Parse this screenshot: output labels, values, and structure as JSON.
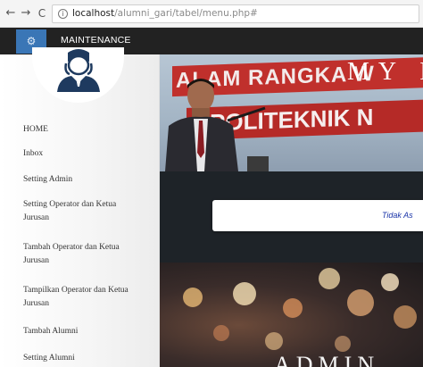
{
  "browser": {
    "url_host": "localhost",
    "url_rest": "/alumni_gari/tabel/menu.php#"
  },
  "app": {
    "title": "MAINTENANCE"
  },
  "sidebar": {
    "items": [
      {
        "label": "HOME"
      },
      {
        "label": "Inbox"
      },
      {
        "label": "Setting Admin"
      },
      {
        "label": "Setting Operator dan Ketua Jurusan"
      },
      {
        "label": "Tambah Operator dan Ketua Jurusan"
      },
      {
        "label": "Tampilkan Operator dan Ketua Jurusan"
      },
      {
        "label": "Tambah Alumni"
      },
      {
        "label": "Setting Alumni"
      }
    ]
  },
  "banner": {
    "line1": "ALAM RANGKA W",
    "line2": "POLITEKNIK N",
    "overlay_title": "MY I"
  },
  "alert": {
    "text": "Tidak As"
  },
  "hero": {
    "title": "ADMIN"
  },
  "colors": {
    "topbar": "#222222",
    "toggle": "#3a76b6",
    "alert_text": "#1a34a8"
  }
}
